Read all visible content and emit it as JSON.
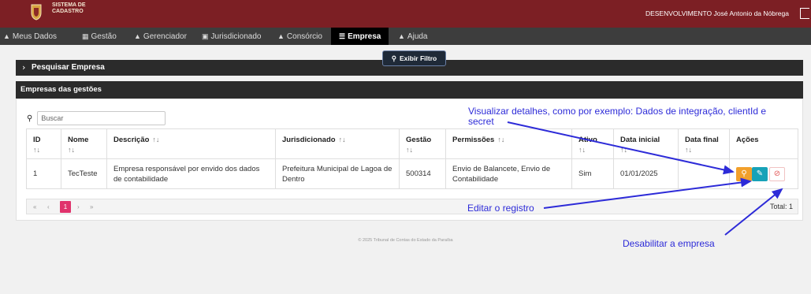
{
  "header": {
    "system_name_line1": "SISTEMA DE",
    "system_name_line2": "CADASTRO",
    "user": "DESENVOLVIMENTO José Antonio da Nóbrega"
  },
  "nav": {
    "items": [
      {
        "label": "Meus Dados",
        "icon": "user-icon"
      },
      {
        "label": "Gestão",
        "icon": "calendar-icon"
      },
      {
        "label": "Gerenciador",
        "icon": "user-icon"
      },
      {
        "label": "Jurisdicionado",
        "icon": "bank-icon"
      },
      {
        "label": "Consórcio",
        "icon": "users-icon"
      },
      {
        "label": "Empresa",
        "icon": "list-icon",
        "active": true
      },
      {
        "label": "Ajuda",
        "icon": "book-icon"
      }
    ]
  },
  "search_panel": {
    "title": "Pesquisar Empresa",
    "filter_button": "Exibir Filtro"
  },
  "list_panel": {
    "title": "Empresas das gestões",
    "search_placeholder": "Buscar"
  },
  "table": {
    "headers": [
      "ID",
      "Nome",
      "Descrição",
      "Jurisdicionado",
      "Gestão",
      "Permissões",
      "Ativo",
      "Data inicial",
      "Data final",
      "Ações"
    ],
    "sort_glyph": "↑↓",
    "rows": [
      {
        "id": "1",
        "nome": "TecTeste",
        "descricao": "Empresa responsável por envido dos dados de contabilidade",
        "jurisdicionado": "Prefeitura Municipal de Lagoa de Dentro",
        "gestao": "500314",
        "permissoes": "Envio de Balancete, Envio de Contabilidade",
        "ativo": "Sim",
        "data_inicial": "01/01/2025",
        "data_final": ""
      }
    ]
  },
  "pagination": {
    "first": "«",
    "prev": "‹",
    "current": "1",
    "next": "›",
    "last": "»",
    "total": "Total: 1"
  },
  "footer": "© 2025 Tribunal de Contas do Estado da Paraíba",
  "annotations": {
    "view_details": "Visualizar detalhes, como por exemplo: Dados de integração, clientId e secret",
    "edit": "Editar o registro",
    "disable": "Desabilitar a empresa"
  },
  "colors": {
    "topbar": "#7c1f24",
    "navbar": "#3d3d3d",
    "view_button": "#f2a02b",
    "edit_button": "#17a2b8",
    "disable_button": "#e35858",
    "page_active": "#e0336c",
    "annotation": "#2d2bd8"
  }
}
